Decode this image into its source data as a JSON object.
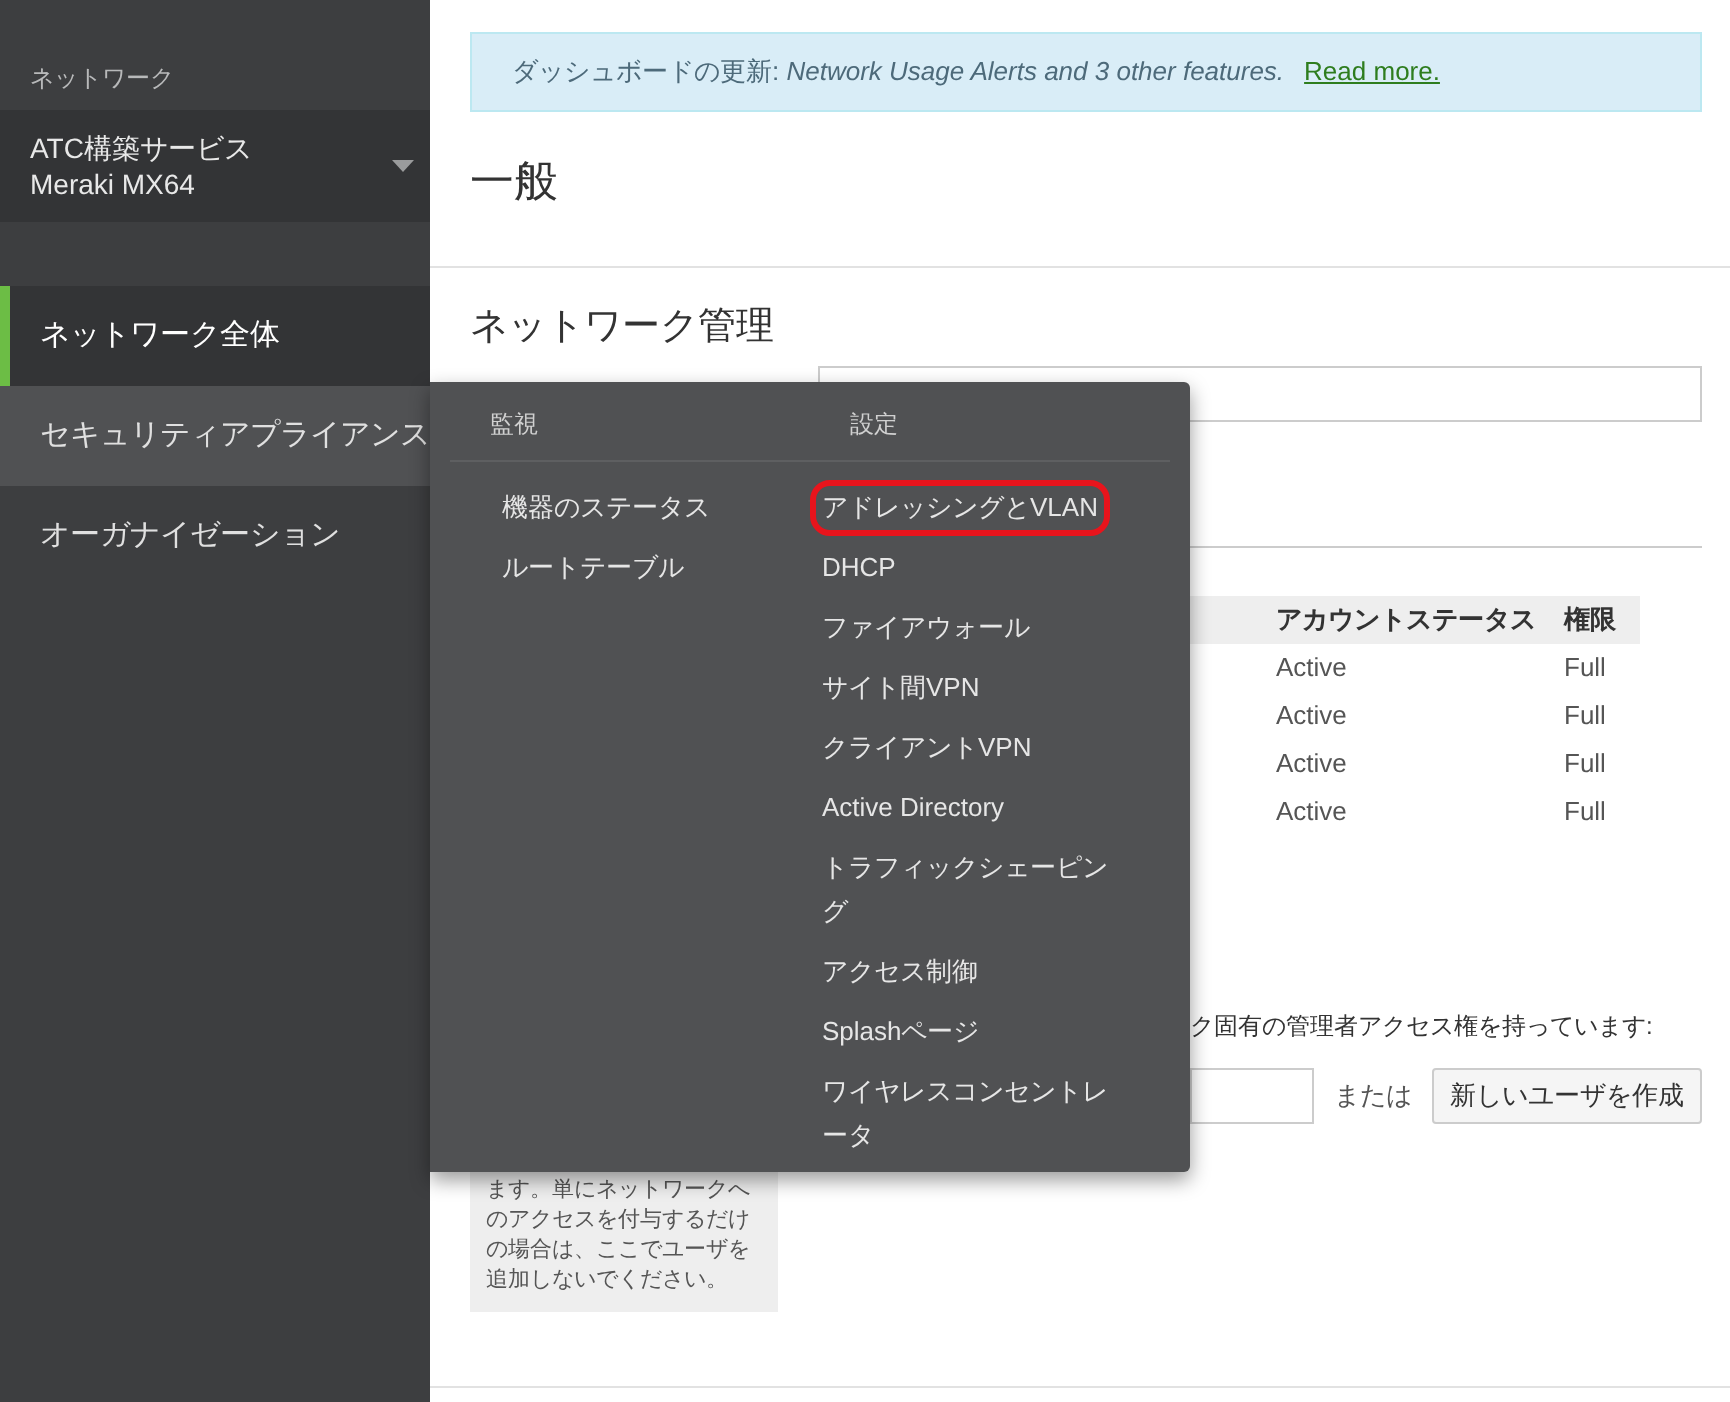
{
  "sidebar": {
    "section_label": "ネットワーク",
    "network_selector": {
      "name": "ATC構築サービス",
      "model": "Meraki MX64"
    },
    "items": [
      {
        "label": "ネットワーク全体",
        "selected": true,
        "highlighted": false
      },
      {
        "label": "セキュリティアプライアンス",
        "selected": false,
        "highlighted": true
      },
      {
        "label": "オーガナイゼーション",
        "selected": false,
        "highlighted": false
      }
    ]
  },
  "banner": {
    "text": "ダッシュボードの更新: *Network Usage Alerts and 3 other features.*",
    "link": "Read more."
  },
  "page_title": "一般",
  "section_title": "ネットワーク管理",
  "admin_table": {
    "columns": [
      "アカウントステータス",
      "権限"
    ],
    "rows": [
      [
        "Active",
        "Full"
      ],
      [
        "Active",
        "Full"
      ],
      [
        "Active",
        "Full"
      ],
      [
        "Active",
        "Full"
      ]
    ]
  },
  "access_text": "ク固有の管理者アクセス権を持っています:",
  "or_text": "または",
  "create_user_button": "新しいユーザを作成",
  "note": "ます。単にネットワークへのアクセスを付与するだけの場合は、ここでユーザを追加しないでください。",
  "menu": {
    "columns": [
      {
        "heading": "監視",
        "items": [
          {
            "label": "機器のステータス",
            "circled": false
          },
          {
            "label": "ルートテーブル",
            "circled": false
          }
        ]
      },
      {
        "heading": "設定",
        "items": [
          {
            "label": "アドレッシングとVLAN",
            "circled": true
          },
          {
            "label": "DHCP",
            "circled": false
          },
          {
            "label": "ファイアウォール",
            "circled": false
          },
          {
            "label": "サイト間VPN",
            "circled": false
          },
          {
            "label": "クライアントVPN",
            "circled": false
          },
          {
            "label": "Active Directory",
            "circled": false
          },
          {
            "label": "トラフィックシェーピング",
            "circled": false
          },
          {
            "label": "アクセス制御",
            "circled": false
          },
          {
            "label": "Splashページ",
            "circled": false
          },
          {
            "label": "ワイヤレスコンセントレータ",
            "circled": false
          }
        ]
      }
    ]
  }
}
